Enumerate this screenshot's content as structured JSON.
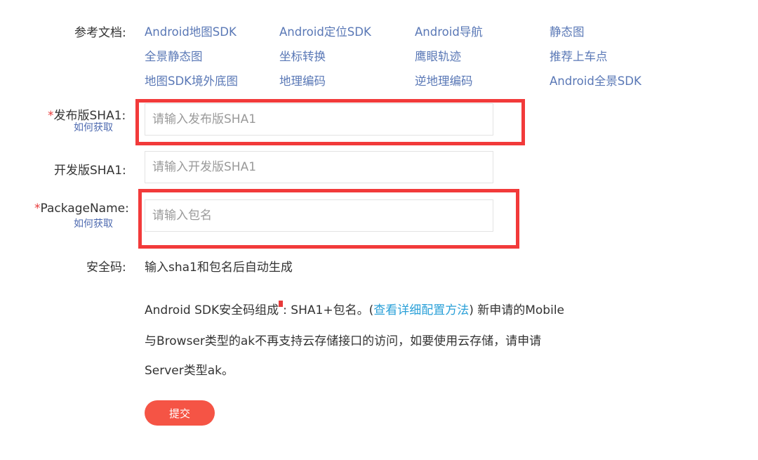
{
  "docs": {
    "label": "参考文档:",
    "links": [
      "Android地图SDK",
      "Android定位SDK",
      "Android导航",
      "静态图",
      "全景静态图",
      "坐标转换",
      "鹰眼轨迹",
      "推荐上车点",
      "地图SDK境外底图",
      "地理编码",
      "逆地理编码",
      "Android全景SDK"
    ]
  },
  "release_sha1": {
    "required_mark": "*",
    "label": "发布版SHA1:",
    "help_link": "如何获取",
    "placeholder": "请输入发布版SHA1"
  },
  "dev_sha1": {
    "label": "开发版SHA1:",
    "placeholder": "请输入开发版SHA1"
  },
  "package_name": {
    "required_mark": "*",
    "label": "PackageName:",
    "help_link": "如何获取",
    "placeholder": "请输入包名"
  },
  "security_code": {
    "label": "安全码:",
    "value": "输入sha1和包名后自动生成"
  },
  "notice": {
    "part1": "Android SDK安全码组成",
    "part2": ": SHA1+包名。(",
    "link": "查看详细配置方法",
    "part3": ") 新申请的Mobile",
    "line2": "与Browser类型的ak不再支持云存储接口的访问，如要使用云存储，请申请",
    "line3": "Server类型ak。"
  },
  "submit_label": "提交",
  "colors": {
    "accent_red": "#f55445",
    "highlight_red": "#f23a3a",
    "link_blue": "#5a78b6",
    "inline_link_blue": "#2aa0d8"
  }
}
